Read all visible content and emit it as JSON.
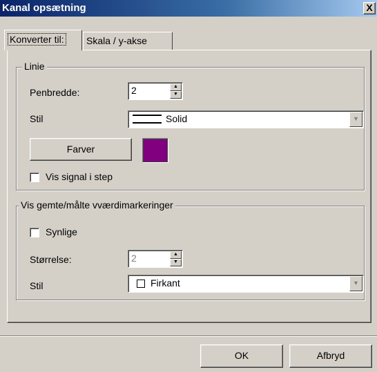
{
  "window": {
    "title": "Kanal opsætning",
    "close_label": "X"
  },
  "tabs": [
    {
      "label": "Konverter til:"
    },
    {
      "label": "Skala / y-akse"
    }
  ],
  "line_group": {
    "legend_label": "Linie",
    "width_label": "Penbredde:",
    "width_value": "2",
    "style_label": "Stil",
    "style_value": "Solid",
    "colors_button_label": "Farver",
    "color_value": "#800080",
    "step_checkbox_label": "Vis signal i step",
    "step_checked": false
  },
  "markers_group": {
    "legend_label": "Vis gemte/målte vværdimarkeringer",
    "visible_checkbox_label": "Synlige",
    "visible_checked": false,
    "size_label": "Størrelse:",
    "size_value": "2",
    "style_label": "Stil",
    "style_value": "Firkant"
  },
  "buttons": {
    "ok_label": "OK",
    "cancel_label": "Afbryd"
  }
}
